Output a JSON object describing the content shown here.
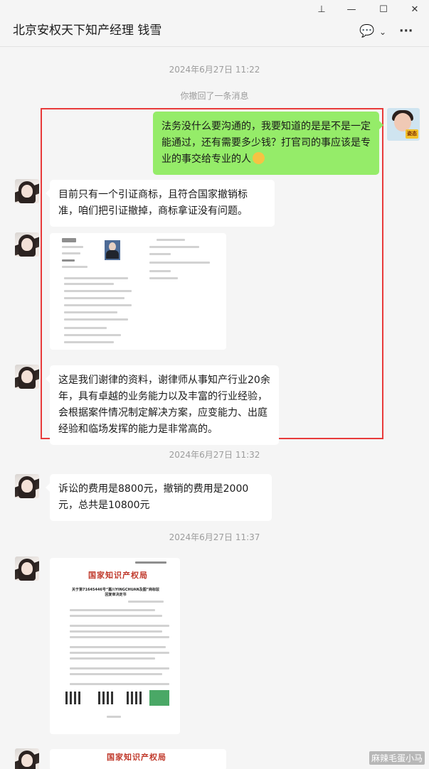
{
  "window": {
    "pin_icon": "pin-icon",
    "minimize_icon": "minimize-icon",
    "maximize_icon": "maximize-icon",
    "close_icon": "close-icon"
  },
  "header": {
    "chat_title": "北京安权天下知产经理 钱雪"
  },
  "messages": {
    "time1": "2024年6月27日 11:22",
    "recall_notice": "你撤回了一条消息",
    "me_msg1": "法务没什么要沟通的，我要知道的是是不是一定能通过，还有需要多少钱？打官司的事应该是专业的事交给专业的人",
    "them_msg1": "目前只有一个引证商标，且符合国家撤销标准，咱们把引证撤掉，商标拿证没有问题。",
    "them_msg2": "这是我们谢律的资料，谢律师从事知产行业20余年，具有卓越的业务能力以及丰富的行业经验，会根据案件情况制定解决方案，应变能力、出庭经验和临场发挥的能力是非常高的。",
    "time2": "2024年6月27日 11:32",
    "them_msg3": "诉讼的费用是8800元，撤销的费用是2000元，总共是10800元",
    "time3": "2024年6月27日 11:37",
    "doc2_title": "国家知识产权局",
    "doc2_subtitle": "关于第71645446号“嘉川YINGCHUAN及图”商标驳回复审决定书",
    "doc3_title": "国家知识产权局"
  },
  "watermark": "麻辣毛蛋小马",
  "colors": {
    "my_bubble": "#95ec69",
    "their_bubble": "#ffffff",
    "highlight_border": "#e83a3a",
    "doc_title_red": "#c0392b"
  }
}
